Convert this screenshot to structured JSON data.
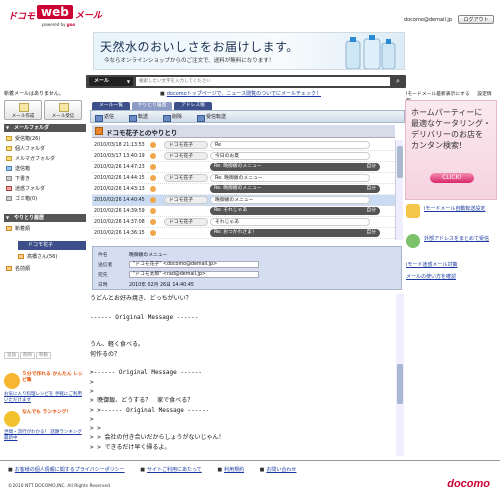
{
  "header": {
    "logo_prefix": "ドコモ",
    "logo_main": "web",
    "logo_suffix": "メール",
    "powered": "powered by",
    "powered_brand": "goo",
    "account": "docomo@demail.jp",
    "logout": "ログアウト"
  },
  "banner": {
    "headline": "天然水のおいしさをお届けします。",
    "sub": "今ならオンラインショップからのご注文で、送料が無料になります！"
  },
  "search": {
    "scope": "メール",
    "placeholder": "検索したい文字を入力してください"
  },
  "left": {
    "new_mail_status": "新着メールはありません。",
    "tab_write": "メール作成",
    "tab_receive": "メール受信",
    "folder_header": "メールフォルダ",
    "folders": [
      {
        "label": "受信箱(26)",
        "icon": "inbox-icon"
      },
      {
        "label": "個人フォルダ",
        "icon": "folder-icon"
      },
      {
        "label": "メルマガフォルダ",
        "icon": "folder-icon"
      },
      {
        "label": "送信箱",
        "icon": "outbox-icon"
      },
      {
        "label": "下書き",
        "icon": "draft-icon"
      },
      {
        "label": "迷惑フォルダ",
        "icon": "spam-folder-icon"
      },
      {
        "label": "ゴミ箱(0)",
        "icon": "trash-icon"
      }
    ],
    "history_header": "やりとり履歴",
    "history_new": "新着順",
    "history_items": [
      "ドコモ花子",
      "高橋さん(56)",
      "名前順"
    ],
    "buttons": [
      "追加",
      "削除",
      "移動"
    ],
    "promo1_title": "５分で作れる かんたん レシピ集",
    "promo1_link": "お気に入り料理レシピを 手軽にご利用いただけます",
    "promo2_title": "なんでも ランキング！",
    "promo2_link": "世間・流行がわかる！ 話題ランキング最新中"
  },
  "notice": "docomoトップページで、ニュース閲覧のついでにメールチェック！",
  "list": {
    "tabs": [
      "メール一覧",
      "やりとり履歴",
      "アドレス帳"
    ],
    "toolbar": [
      "返信",
      "転送",
      "削除",
      "受信転送"
    ],
    "title": "ドコモ花子とのやりとり",
    "rows": [
      {
        "date": "2010/03/18 21:13:53",
        "sender": "ドコモ花子",
        "subject": "Re",
        "dir": "in"
      },
      {
        "date": "2010/03/17 13:40:19",
        "sender": "ドコモ花子",
        "subject": "今日のお夏",
        "dir": "in"
      },
      {
        "date": "2010/02/26 14:47:23",
        "sender": "",
        "subject": "Re: 晩御飯のメニュー",
        "dir": "out",
        "me": "自分"
      },
      {
        "date": "2010/02/26 14:44:15",
        "sender": "ドコモ花子",
        "subject": "Re: 晩御飯のメニュー",
        "dir": "in"
      },
      {
        "date": "2010/02/26 14:43:13",
        "sender": "",
        "subject": "Re: 晩御飯のメニュー",
        "dir": "out",
        "me": "自分"
      },
      {
        "date": "2010/02/26 14:40:45",
        "sender": "ドコモ花子",
        "subject": "晩御飯のメニュー",
        "dir": "in",
        "selected": true
      },
      {
        "date": "2010/02/26 14:39:59",
        "sender": "",
        "subject": "Re: それじゃあ",
        "dir": "out",
        "me": "自分"
      },
      {
        "date": "2010/02/26 14:37:08",
        "sender": "ドコモ花子",
        "subject": "それじゃあ",
        "dir": "in"
      },
      {
        "date": "2010/02/26 14:36:15",
        "sender": "",
        "subject": "Re: おつかれさま！",
        "dir": "out",
        "me": "自分"
      }
    ]
  },
  "detail": {
    "subject_label": "件名",
    "subject": "晩御飯のメニュー",
    "from_label": "送信者",
    "from": "\"ドコモ花子\" <docomo@demail.jp>",
    "to_label": "宛先",
    "to": "\"ドコモ太郎\" <rad@demail.jp>",
    "date_label": "日時",
    "date": "2010年 02月 26日 14:40:45"
  },
  "body_lines": [
    "うどんとお好み焼き、どっちがいい？",
    "",
    "------ Original Message ------",
    "",
    "",
    "うん、軽く食べる。",
    "何作るの？",
    "",
    ">------ Original Message ------",
    ">",
    ">",
    "> 晩御飯、どうする？　家で食べる？",
    "> >------ Original Message ------",
    ">",
    "> >",
    "> > 会社の付き合いだからしょうがないじゃん！",
    "> > できるだけ早く帰るよ。"
  ],
  "right": {
    "links_top": [
      "iモードメール差新表示にする",
      "設定情報"
    ],
    "ad_line1": "ホームパーティーに",
    "ad_line2": "最適なケータリング・",
    "ad_line3": "デリバリーのお店を",
    "ad_line4": "カンタン検索!",
    "ad_button": "CLICK!",
    "link1": "iモードメール自動転送設定",
    "link2": "外部アドレスをまとめて受信",
    "link3": "iモード迷惑メール対策",
    "link4": "メールの使い方を確認"
  },
  "footer": {
    "links": [
      "お客様の個人情報に関するプライバシーポリシー",
      "サイトご利用にあたって",
      "利用規約",
      "お問い合わせ"
    ],
    "copyright": "©2010 NTT DOCOMO,INC. All Rights Reserved.",
    "brand": "docomo"
  }
}
